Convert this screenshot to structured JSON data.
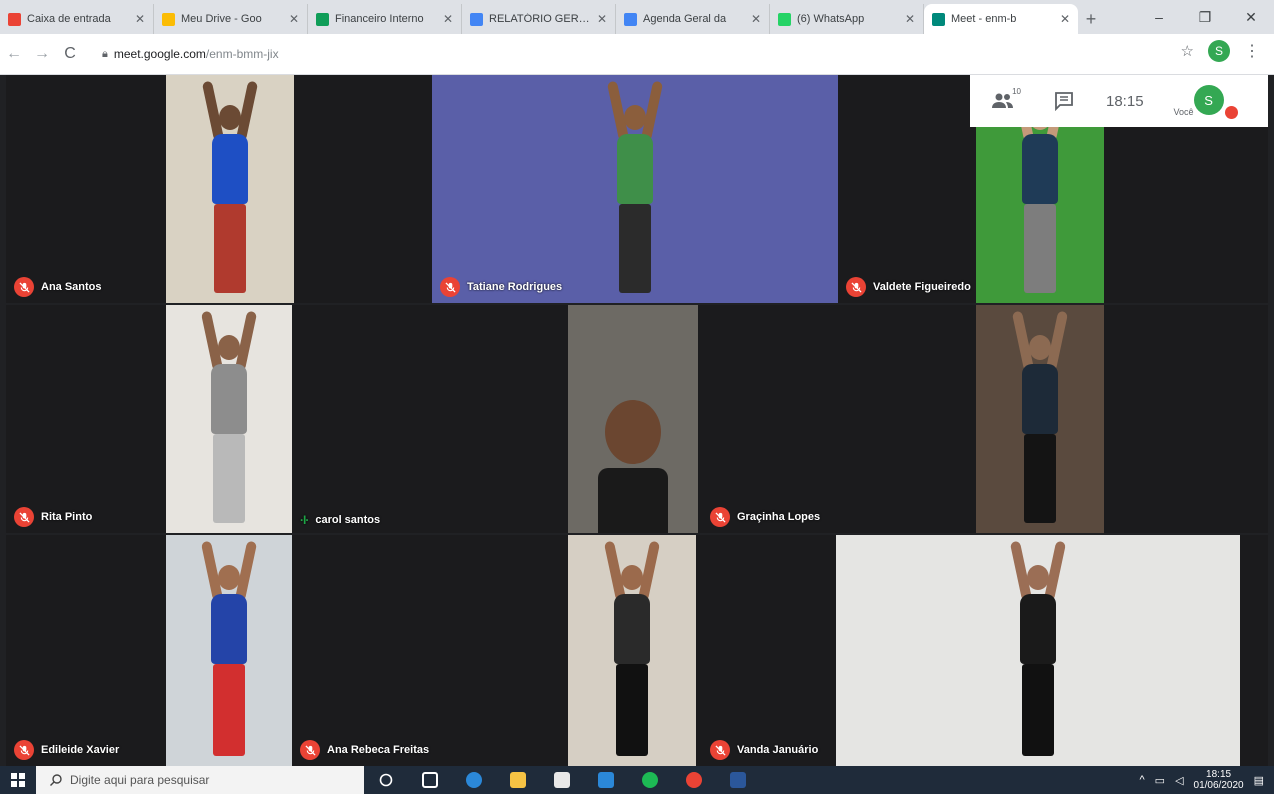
{
  "browser": {
    "tabs": [
      {
        "title": "Caixa de entrada",
        "favicon_color": "#ea4335",
        "active": false
      },
      {
        "title": "Meu Drive - Goo",
        "favicon_color": "#fbbc04",
        "active": false
      },
      {
        "title": "Financeiro Interno",
        "favicon_color": "#0f9d58",
        "active": false
      },
      {
        "title": "RELATÓRIO GERAL",
        "favicon_color": "#4285f4",
        "active": false
      },
      {
        "title": "Agenda Geral da",
        "favicon_color": "#4285f4",
        "active": false
      },
      {
        "title": "(6) WhatsApp",
        "favicon_color": "#25d366",
        "active": false
      },
      {
        "title": "Meet - enm-b",
        "favicon_color": "#00897b",
        "active": true
      }
    ],
    "new_tab": "+",
    "window_controls": {
      "minimize": "–",
      "maximize": "❐",
      "close": "✕"
    },
    "nav": {
      "back": "←",
      "forward": "→",
      "reload": "C"
    },
    "url_host": "meet.google.com",
    "url_path": "/enm-bmm-jix",
    "profile_initial": "S",
    "menu": "⋮",
    "bookmark": "☆"
  },
  "meet": {
    "participants_count": "10",
    "clock": "18:15",
    "you_label": "Você",
    "you_initial": "S",
    "tiles": [
      {
        "name": "Ana Santos",
        "muted": true
      },
      {
        "name": "Tatiane Rodrigues",
        "muted": true
      },
      {
        "name": "Valdete Figueiredo",
        "muted": true
      },
      {
        "name": "Rita Pinto",
        "muted": true
      },
      {
        "name": "carol santos",
        "muted": false
      },
      {
        "name": "Graçinha Lopes",
        "muted": true
      },
      {
        "name": "Edileide Xavier",
        "muted": true
      },
      {
        "name": "Ana Rebeca Freitas",
        "muted": true
      },
      {
        "name": "Vanda Januário",
        "muted": true
      }
    ]
  },
  "taskbar": {
    "search_placeholder": "Digite aqui para pesquisar",
    "time": "18:15",
    "date": "01/06/2020",
    "apps": [
      {
        "icon": "task-view-icon",
        "color": "#ffffff"
      },
      {
        "icon": "edge-icon",
        "color": "#2b88d8"
      },
      {
        "icon": "file-explorer-icon",
        "color": "#f6c344"
      },
      {
        "icon": "store-icon",
        "color": "#e8e8e8"
      },
      {
        "icon": "mail-icon",
        "color": "#2b88d8"
      },
      {
        "icon": "spotify-icon",
        "color": "#1db954"
      },
      {
        "icon": "chrome-icon",
        "color": "#ea4335"
      },
      {
        "icon": "word-icon",
        "color": "#2b579a"
      }
    ]
  }
}
